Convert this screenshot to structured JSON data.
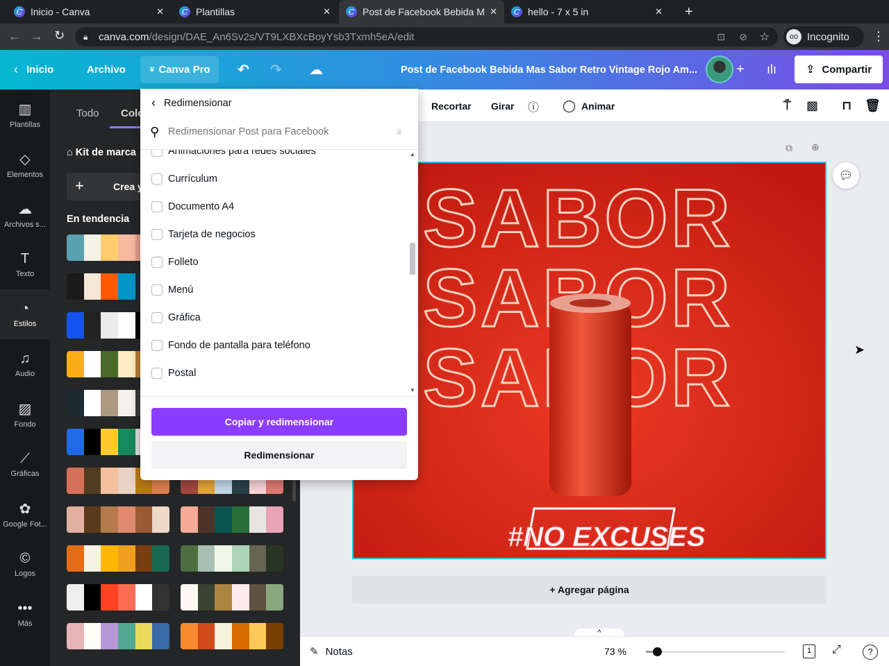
{
  "browser": {
    "tabs": [
      {
        "title": "Inicio - Canva"
      },
      {
        "title": "Plantillas"
      },
      {
        "title": "Post de Facebook Bebida M"
      },
      {
        "title": "hello - 7 x 5 in"
      }
    ],
    "url_domain": "canva.com",
    "url_path": "/design/DAE_An6Sv2s/VT9LXBXcBoyYsb3Txmh5eA/edit",
    "profile": "Incognito"
  },
  "header": {
    "home": "Inicio",
    "file": "Archivo",
    "pro": "Canva Pro",
    "title": "Post de Facebook Bebida Mas Sabor Retro Vintage Rojo Am...",
    "share": "Compartir"
  },
  "sidebar": {
    "items": [
      {
        "label": "Plantillas",
        "icon": "▥"
      },
      {
        "label": "Elementos",
        "icon": "◇"
      },
      {
        "label": "Archivos s...",
        "icon": "☁"
      },
      {
        "label": "Texto",
        "icon": "T"
      },
      {
        "label": "Estilos",
        "icon": "◔"
      },
      {
        "label": "Audio",
        "icon": "♫"
      },
      {
        "label": "Fondo",
        "icon": "▨"
      },
      {
        "label": "Gráficas",
        "icon": "⟋"
      },
      {
        "label": "Google Fot...",
        "icon": "✿"
      },
      {
        "label": "Logos",
        "icon": "©"
      },
      {
        "label": "Más",
        "icon": "•••"
      }
    ]
  },
  "panel": {
    "tabs": [
      "Todo",
      "Colo"
    ],
    "brand_kit": "Kit de marca",
    "create": "Crea y",
    "trending": "En tendencia",
    "palettes_left": [
      [
        "#5aa0b0",
        "#f3f2e6",
        "#fecb6d",
        "#f8b99e",
        "#e8a08a",
        "#b56a4a"
      ],
      [
        "#1a1a1a",
        "#f5e6d6",
        "#ff5a00",
        "#0096c8",
        "#1d2a3a",
        "#ffffff"
      ],
      [
        "#1652f0",
        "#232323",
        "#ebebeb",
        "#ffffff",
        "#000000",
        "#444444"
      ],
      [
        "#f9ae19",
        "#ffffff",
        "#4a6a2a",
        "#fdecc4",
        "#b58030",
        "#4a3a20"
      ],
      [
        "#1e2a32",
        "#ffffff",
        "#ac9a80",
        "#f3f1ec",
        "#3a3a3a",
        "#c0b8a8"
      ],
      [
        "#1f6ae8",
        "#000000",
        "#fecb2e",
        "#168a5a",
        "#e0e0e0",
        "#ffffff"
      ],
      [
        "#d4705a",
        "#523d22",
        "#f5c09e",
        "#e7d2c4",
        "#b97c14",
        "#dd8050"
      ],
      [
        "#e2b0a0",
        "#5a3a1c",
        "#b57a4a",
        "#e08a70",
        "#9a5a32",
        "#ecd9c8"
      ],
      [
        "#e36d16",
        "#f5f3e6",
        "#feb705",
        "#efa020",
        "#7a3e10",
        "#176a50"
      ],
      [
        "#eeeeee",
        "#000000",
        "#fe4320",
        "#fe6c56",
        "#ffffff",
        "#333333"
      ],
      [
        "#e8b4b8",
        "#fffdf4",
        "#b898d8",
        "#50a890",
        "#e8dc5a",
        "#3a6aa8"
      ]
    ],
    "palettes_right": [
      [
        "#a04840",
        "#e4a43a",
        "#c4d8e8",
        "#2a4048",
        "#fad4d8",
        "#df7a74"
      ],
      [
        "#f4aa96",
        "#4c3228",
        "#075450",
        "#2a6e38",
        "#e8e4e4",
        "#eaa4b8"
      ],
      [
        "#4e6e40",
        "#a8c0b4",
        "#f2f6e8",
        "#acd4b8",
        "#656454",
        "#283424"
      ],
      [
        "#fef8f2",
        "#3a4232",
        "#ac8640",
        "#feeaea",
        "#5e5240",
        "#8aa880"
      ],
      [
        "#f88a30",
        "#d04a1a",
        "#f6f2dc",
        "#d86c00",
        "#fecb5a",
        "#7a4004"
      ]
    ]
  },
  "popup": {
    "title": "Redimensionar",
    "search_placeholder": "Redimensionar Post para Facebook",
    "options": [
      "Animaciones para redes sociales",
      "Currículum",
      "Documento A4",
      "Tarjeta de negocios",
      "Folleto",
      "Menú",
      "Gráfica",
      "Fondo de pantalla para teléfono",
      "Postal"
    ],
    "copy_resize": "Copiar y redimensionar",
    "resize": "Redimensionar"
  },
  "toolbar": {
    "crop": "Recortar",
    "rotate": "Girar",
    "animate": "Animar"
  },
  "design": {
    "word": "SABOR",
    "tag": "#NO EXCUSES"
  },
  "canvas": {
    "add_page": "+ Agregar página"
  },
  "bottom": {
    "notes": "Notas",
    "zoom": "73 %",
    "zoom_fraction": 0.08,
    "page": "1"
  },
  "colors": {
    "accent": "#8b3dff",
    "selection": "#27c6da",
    "design_bg": "#d8261a"
  }
}
